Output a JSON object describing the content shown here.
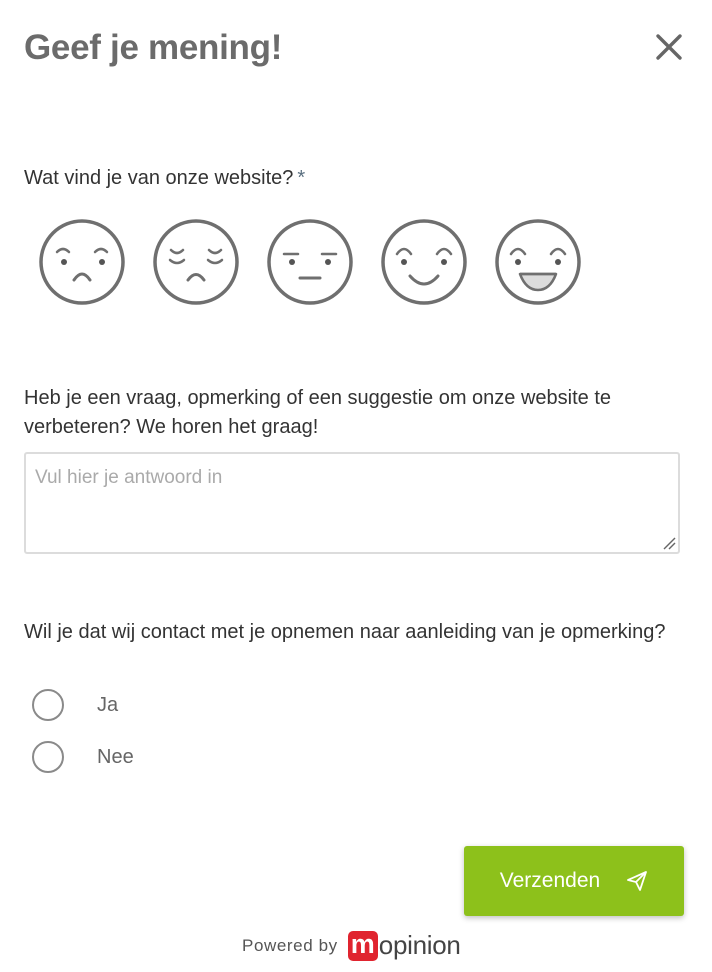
{
  "header": {
    "title": "Geef je mening!",
    "close_icon": "close-icon"
  },
  "question1": {
    "label": "Wat vind je van onze website?",
    "required_marker": "*",
    "options": [
      {
        "icon": "very-unhappy-face-icon",
        "rating": 1
      },
      {
        "icon": "unhappy-face-icon",
        "rating": 2
      },
      {
        "icon": "neutral-face-icon",
        "rating": 3
      },
      {
        "icon": "happy-face-icon",
        "rating": 4
      },
      {
        "icon": "very-happy-face-icon",
        "rating": 5
      }
    ]
  },
  "question2": {
    "label": "Heb je een vraag, opmerking of een suggestie om onze website te verbeteren? We horen het graag!",
    "value": "",
    "placeholder": "Vul hier je antwoord in"
  },
  "question3": {
    "label": "Wil je dat wij contact met je opnemen naar aanleiding van je opmerking?",
    "options": [
      "Ja",
      "Nee"
    ],
    "selected": null
  },
  "submit": {
    "label": "Verzenden",
    "icon": "send-icon",
    "color": "#8dc11b"
  },
  "footer": {
    "powered_by": "Powered by",
    "brand_initial": "m",
    "brand_rest": "opinion",
    "brand_color": "#e0242f"
  }
}
